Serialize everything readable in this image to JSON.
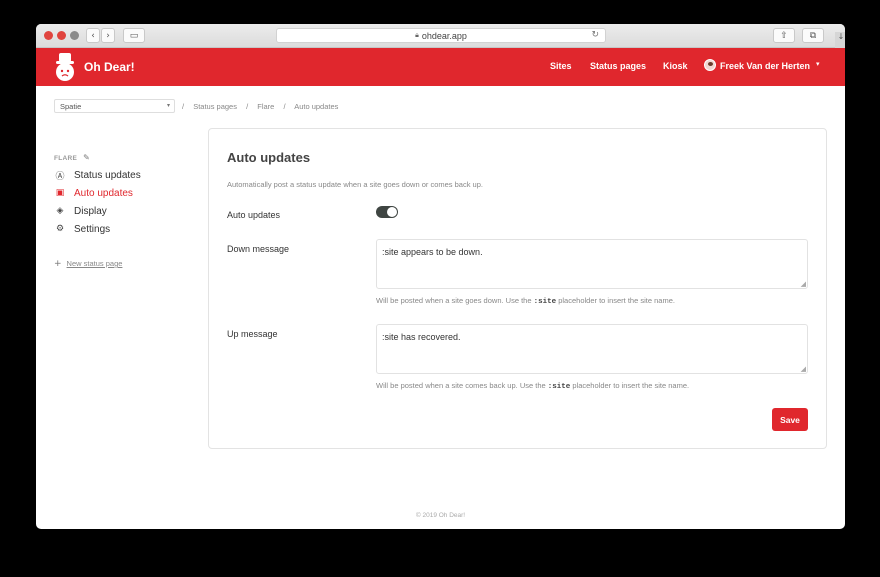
{
  "browser": {
    "address": "ohdear.app",
    "icons": [
      "close-dot",
      "minimize-dot",
      "zoom-dot",
      "back-icon",
      "forward-icon",
      "sidebar-icon",
      "lock-icon",
      "reload-icon",
      "share-icon",
      "tabs-icon",
      "download-icon"
    ]
  },
  "header": {
    "brand": "Oh Dear!",
    "nav": [
      "Sites",
      "Status pages",
      "Kiosk"
    ],
    "user": "Freek Van der Herten",
    "accent": "#e0272d"
  },
  "breadcrumb": {
    "team": "Spatie",
    "items": [
      "/",
      "Status pages",
      "/",
      "Flare",
      "/",
      "Auto updates"
    ]
  },
  "sidebar": {
    "heading": "FLARE",
    "items": [
      {
        "label": "Status updates",
        "icon": "broadcast-icon"
      },
      {
        "label": "Auto updates",
        "icon": "robot-icon",
        "active": true
      },
      {
        "label": "Display",
        "icon": "paint-bucket-icon"
      },
      {
        "label": "Settings",
        "icon": "cogs-icon"
      }
    ],
    "new_page": "New status page"
  },
  "form": {
    "title": "Auto updates",
    "description": "Automatically post a status update when a site goes down or comes back up.",
    "auto_label": "Auto updates",
    "auto_enabled": true,
    "down_label": "Down message",
    "down_value": ":site appears to be down.",
    "down_help_pre": "Will be posted when a site goes down. Use the",
    "down_help_code": ":site",
    "down_help_post": "placeholder to insert the site name.",
    "up_label": "Up message",
    "up_value": ":site has recovered.",
    "up_help_pre": "Will be posted when a site comes back up. Use the",
    "up_help_code": ":site",
    "up_help_post": "placeholder to insert the site name.",
    "save_label": "Save"
  },
  "footer": "© 2019 Oh Dear!"
}
